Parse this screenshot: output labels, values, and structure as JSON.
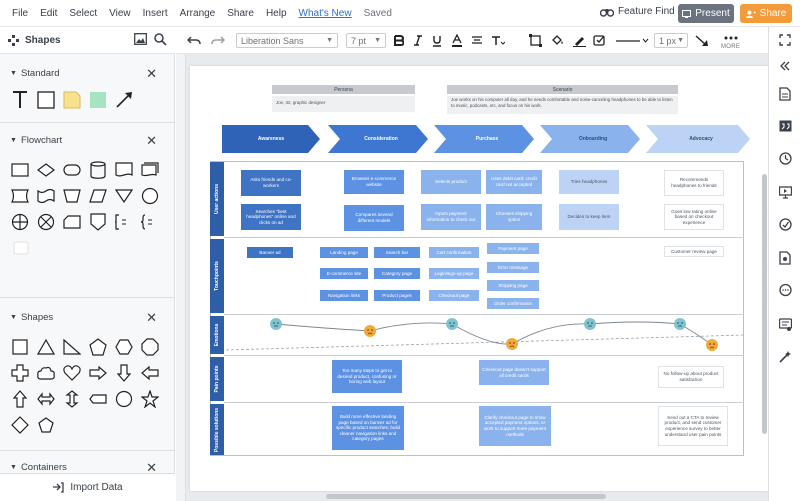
{
  "menu": {
    "items": [
      "File",
      "Edit",
      "Select",
      "View",
      "Insert",
      "Arrange",
      "Share",
      "Help"
    ],
    "whats_new": "What's New",
    "saved": "Saved",
    "feature_find": "Feature Find",
    "present": "Present",
    "share": "Share"
  },
  "left_panel": {
    "title": "Shapes",
    "sections": {
      "standard": "Standard",
      "flowchart": "Flowchart",
      "shapes": "Shapes",
      "containers": "Containers"
    },
    "import_data": "Import Data"
  },
  "toolbar": {
    "font": "Liberation Sans",
    "font_size": "7 pt",
    "line_width": "1 px",
    "more": "MORE"
  },
  "diagram": {
    "personas": [
      {
        "label": "Persona",
        "text": "Joe, 32, graphic designer"
      },
      {
        "label": "Scenario",
        "text": "Joe works on his computer all day, and he needs comfortable and noise-canceling headphones to be able to listen to music, podcasts, etc, and focus on his work."
      }
    ],
    "phases": [
      "Awareness",
      "Consideration",
      "Purchase",
      "Onboarding",
      "Advocacy"
    ],
    "rows": [
      "User actions",
      "Touchpoints",
      "Emotions",
      "Pain points",
      "Possible solutions"
    ],
    "user_actions": [
      "Asks friends and co-workers",
      "Searches \"best headphones\" online and clicks on ad",
      "Browses e-commerce website",
      "Compares several different models",
      "Selects product",
      "Inputs payment information to check out",
      "Uses debit card; credit card not accepted",
      "Chooses shipping option",
      "Tries headphones",
      "Decides to keep item",
      "Recommends headphones to friends",
      "Goes low rating online based on checkout experience"
    ],
    "touchpoints": [
      "Banner ad",
      "Landing page",
      "Search bar",
      "E-commerce site",
      "Category page",
      "Navigation links",
      "Product pages",
      "Cart confirmation",
      "Login/sign-up page",
      "Checkout page",
      "Payment page",
      "Error message",
      "Shipping page",
      "Order confirmation",
      "Customer review page"
    ],
    "pain_points": [
      "Too many steps to get to desired product, confusing or boring web layout",
      "Checkout page doesn't support all credit cards",
      "No follow-up about product satisfaction"
    ],
    "solutions": [
      "Build more effective landing page based on banner ad for specific product searches; build cleaner navigation links and category pages",
      "Clarify checkout page to show accepted payment options, or work to support more payment methods",
      "Send out a CTA to review product, and send customer experience survey to better understand user pain points"
    ]
  }
}
